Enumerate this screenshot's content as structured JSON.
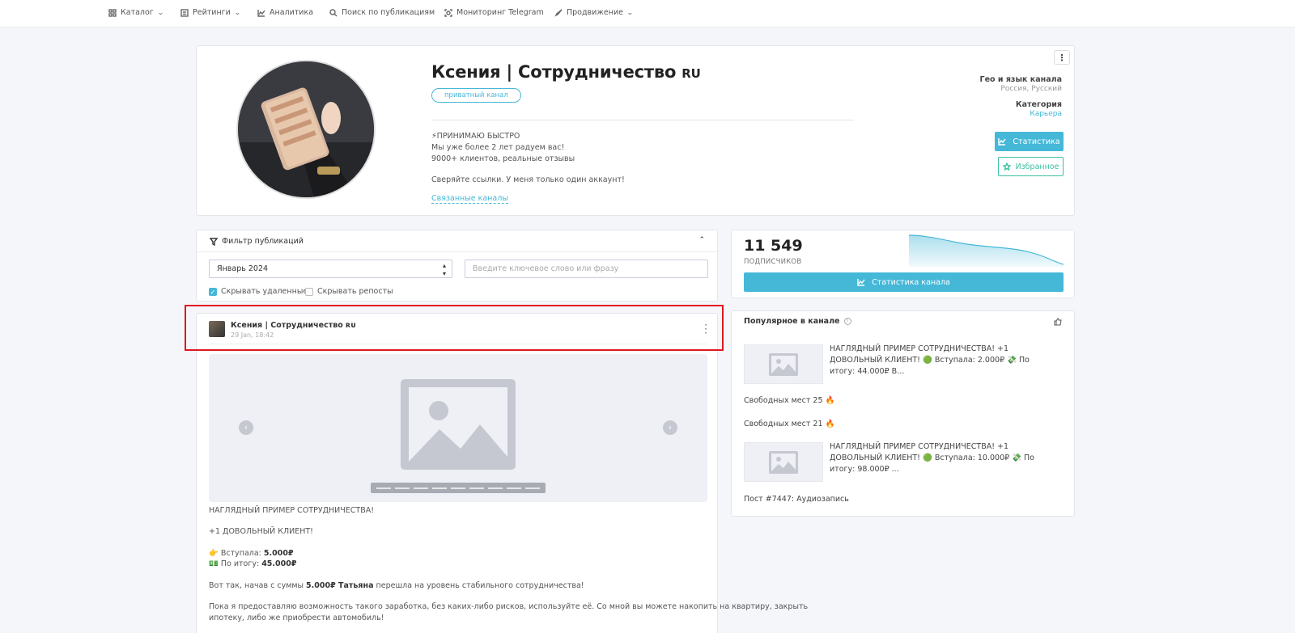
{
  "nav": {
    "catalog": "Каталог",
    "ratings": "Рейтинги",
    "analytics": "Аналитика",
    "search": "Поиск по публикациям",
    "monitoring": "Мониторинг Telegram",
    "promotion": "Продвижение"
  },
  "channel": {
    "title": "Ксения | Сотрудничество",
    "title_tag": "RU",
    "private_badge": "приватный канал",
    "desc_line1": "⚡ПРИНИМАЮ БЫСТРО",
    "desc_line2": "Мы уже более 2 лет радуем вас!",
    "desc_line3": "9000+ клиентов, реальные отзывы",
    "desc_line4": "Сверяйте ссылки. У меня только один аккаунт!",
    "related_link": "Связанные каналы",
    "geo_label": "Гео и язык канала",
    "geo_value": "Россия, Русский",
    "category_label": "Категория",
    "category_value": "Карьера",
    "stats_button": "Статистика",
    "favorite_button": "Избранное"
  },
  "filter": {
    "header": "Фильтр публикаций",
    "month_value": "Январь 2024",
    "keyword_placeholder": "Введите ключевое слово или фразу",
    "hide_deleted_label": "Скрывать удаленные",
    "hide_deleted_checked": true,
    "hide_reposts_label": "Скрывать репосты",
    "hide_reposts_checked": false
  },
  "post": {
    "author": "Ксения | Сотрудничество",
    "author_tag": "ʀᴜ",
    "date": "29 Jan, 18:42",
    "line1": "НАГЛЯДНЫЙ ПРИМЕР СОТРУДНИЧЕСТВА!",
    "line2": "+1 ДОВОЛЬНЫЙ КЛИЕНТ!",
    "entry_label": "👉 Вступала: ",
    "entry_value": "5.000₽",
    "total_label": "💵 По итогу: ",
    "total_value": "45.000₽",
    "story_prefix": "Вот так, начав с суммы ",
    "story_bold": "5.000₽ Татьяна",
    "story_suffix": " перешла на уровень стабильного сотрудничества!",
    "para_line1": "Пока я предоставляю возможность такого заработка, без каких-либо рисков, используйте её. Со мной вы можете накопить на квартиру, закрыть",
    "para_line2": "ипотеку, либо же приобрести автомобиль!"
  },
  "subscribers": {
    "count": "11 549",
    "label": "ПОДПИСЧИКОВ",
    "button": "Статистика канала"
  },
  "popular": {
    "title": "Популярное в канале",
    "item1": "НАГЛЯДНЫЙ ПРИМЕР СОТРУДНИЧЕСТВА! +1 ДОВОЛЬНЫЙ КЛИЕНТ! 🟢 Вступала: 2.000₽ 💸 По итогу: 44.000₽ В...",
    "item2": "Свободных мест 25 🔥",
    "item3": "Свободных мест 21 🔥",
    "item4": "НАГЛЯДНЫЙ ПРИМЕР СОТРУДНИЧЕСТВА! +1 ДОВОЛЬНЫЙ КЛИЕНТ! 🟢 Вступала: 10.000₽ 💸 По итогу: 98.000₽ ...",
    "item5": "Пост #7447: Аудиозапись"
  },
  "colors": {
    "accent": "#45b8d8",
    "favorite": "#3cc0a4",
    "highlight": "#e0171f"
  }
}
